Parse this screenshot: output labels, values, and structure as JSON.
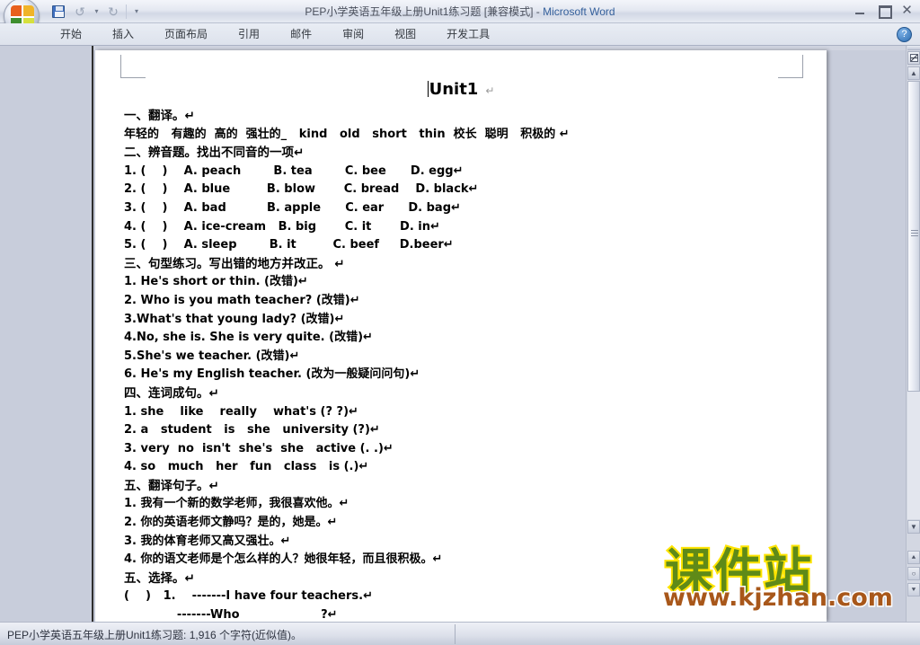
{
  "window": {
    "title": "PEP小学英语五年级上册Unit1练习题 [兼容模式]",
    "separator": " - ",
    "app_name": "Microsoft Word",
    "minimize_label": "最小化",
    "restore_label": "还原",
    "close_label": "✕",
    "help_label": "?"
  },
  "quick_access": {
    "office_button": "Office 按钮",
    "save": "保存",
    "undo": "撤消",
    "undo_dropdown": "▾",
    "redo": "恢复",
    "customize": "▾"
  },
  "ribbon": {
    "tabs": [
      {
        "label": "开始",
        "active": false
      },
      {
        "label": "插入",
        "active": false
      },
      {
        "label": "页面布局",
        "active": false
      },
      {
        "label": "引用",
        "active": false
      },
      {
        "label": "邮件",
        "active": false
      },
      {
        "label": "审阅",
        "active": false
      },
      {
        "label": "视图",
        "active": false
      },
      {
        "label": "开发工具",
        "active": false
      }
    ]
  },
  "document": {
    "title": "Unit1",
    "pilcrow": "↵",
    "lines": [
      "一、翻译。↵",
      "年轻的   有趣的  高的  强壮的_   kind   old   short   thin  校长  聪明   积极的 ↵",
      "二、辨音题。找出不同音的一项↵",
      "1. (    )    A. peach        B. tea        C. bee      D. egg↵",
      "2. (    )    A. blue         B. blow       C. bread    D. black↵",
      "3. (    )    A. bad          B. apple      C. ear      D. bag↵",
      "4. (    )    A. ice-cream   B. big       C. it       D. in↵",
      "5. (    )    A. sleep        B. it         C. beef     D.beer↵",
      "三、句型练习。写出错的地方并改正。 ↵",
      "1. He's short or thin. (改错)↵",
      "2. Who is you math teacher? (改错)↵",
      "3.What's that young lady? (改错)↵",
      "4.No, she is. She is very quite. (改错)↵",
      "5.She's we teacher. (改错)↵",
      "6. He's my English teacher. (改为一般疑问问句)↵",
      "四、连词成句。↵",
      "1. she    like    really    what's (? ?)↵",
      "2. a   student   is   she   university (?)↵",
      "3. very  no  isn't  she's  she   active (. .)↵",
      "4. so   much   her   fun   class   is (.)↵",
      "五、翻译句子。↵",
      "1. 我有一个新的数学老师，我很喜欢他。↵",
      "2. 你的英语老师文静吗？是的，她是。↵",
      "3. 我的体育老师又高又强壮。↵",
      "4. 你的语文老师是个怎么样的人？她很年轻，而且很积极。↵",
      "五、选择。↵",
      "(    )   1.    -------I have four teachers.↵",
      "             -------Who                    ?↵"
    ]
  },
  "watermark": {
    "chinese": "课件站",
    "url": "www.kjzhan.com",
    "text_color": "#5f8a18",
    "outline_color": "#ffe400",
    "url_color": "#a8571a"
  },
  "scrollbar": {
    "split_button": "拆分窗口",
    "up_arrow": "▲",
    "down_arrow": "▼",
    "previous_page": "⯅",
    "select_browse_object": "○",
    "next_page": "⯆"
  },
  "status_bar": {
    "text": "PEP小学英语五年级上册Unit1练习题: 1,916 个字符(近似值)。"
  },
  "colors": {
    "accent": "#35609c",
    "chrome": "#d3d7e2",
    "workspace": "#c8cddb",
    "page": "#ffffff"
  }
}
